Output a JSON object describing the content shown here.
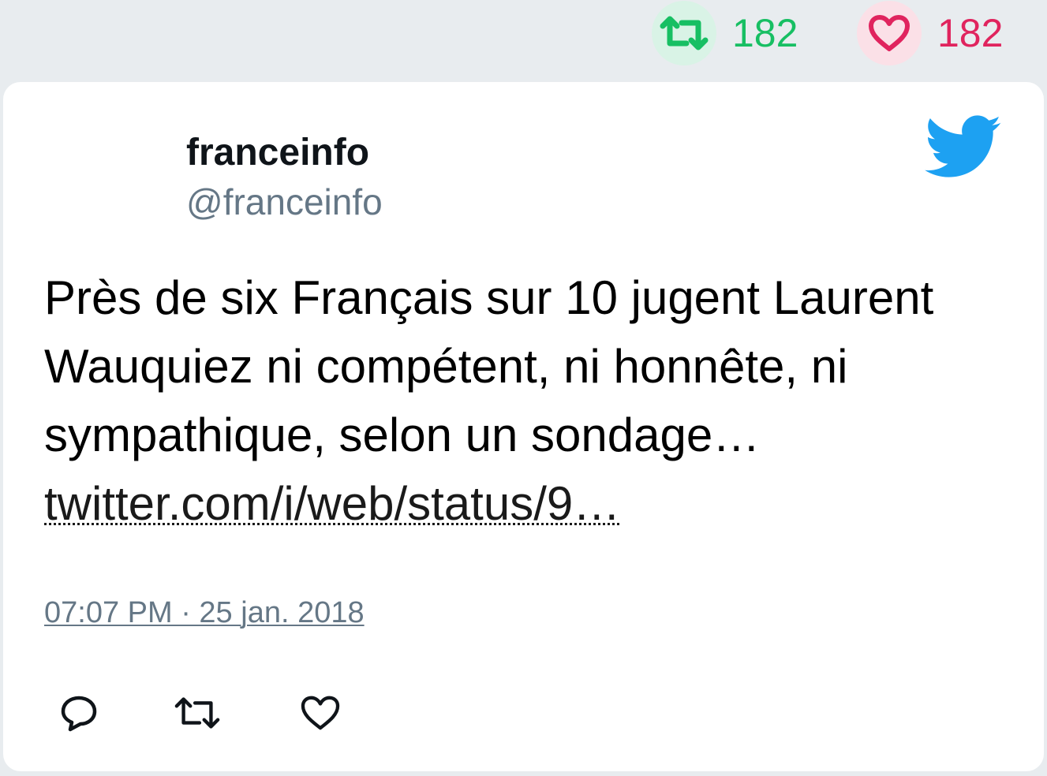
{
  "stats": {
    "retweets": "182",
    "likes": "182"
  },
  "tweet": {
    "display_name": "franceinfo",
    "handle": "@franceinfo",
    "text": "Près de six Français sur 10 jugent Laurent Wauquiez ni compétent, ni honnête, ni sympathique, selon un sondage… ",
    "link_text": "twitter.com/i/web/status/9…",
    "timestamp": "07:07 PM · 25 jan. 2018"
  },
  "icons": {
    "brand": "twitter-bird-icon",
    "retweet": "retweet-icon",
    "like": "heart-icon",
    "reply": "reply-icon"
  },
  "colors": {
    "retweet": "#17bf63",
    "like": "#e0245e",
    "twitter_blue": "#1da1f2",
    "muted": "#657786"
  }
}
